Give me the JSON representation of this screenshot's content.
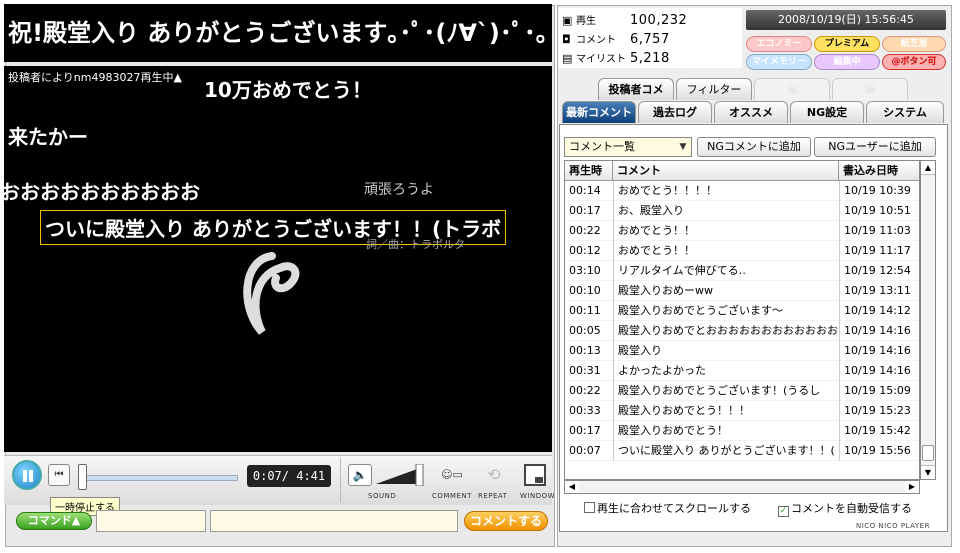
{
  "player": {
    "title": "祝!殿堂入り ありがとうございます｡･ﾟ･(ﾉ∀`)･ﾟ･｡",
    "status": "投稿者によりnm4983027再生中▲",
    "danmaku": [
      "10万おめでとう！",
      "来たかー",
      "おおおおおおおおおお",
      "ついに殿堂入り ありがとうございます！！(トラボ"
    ],
    "video_text": [
      "頑張ろうよ",
      "詞／曲：トラボルタ"
    ]
  },
  "controls": {
    "time": "0:07/ 4:41",
    "progress": 0.025,
    "labels": {
      "sound": "SOUND",
      "comment": "COMMENT",
      "repeat": "REPEAT",
      "window": "WINDOW"
    },
    "tooltip": "一時停止する",
    "command_button": "コマンド▲",
    "submit_button": "コメントする",
    "command_value": "",
    "comment_value": ""
  },
  "stats": {
    "plays_label": "再生",
    "plays": "100,232",
    "comments_label": "コメント",
    "comments": "6,757",
    "mylist_label": "マイリスト",
    "mylist": "5,218"
  },
  "datetime": "2008/10/19(日) 15:56:45",
  "badges": [
    "エコノミー",
    "プレミアム",
    "紙芝居",
    "マイメモリー",
    "編集中",
    "@ボタン可"
  ],
  "tabs": {
    "top": [
      "投稿者コメ",
      "フィルター"
    ],
    "main": [
      "最新コメント",
      "過去ログ",
      "オススメ",
      "NG設定",
      "システム"
    ]
  },
  "panel": {
    "select_value": "コメント一覧",
    "ng_comment_button": "NGコメントに追加",
    "ng_user_button": "NGユーザーに追加",
    "headers": [
      "再生時",
      "コメント",
      "書込み日時"
    ],
    "rows": [
      {
        "time": "00:14",
        "comment": "おめでとう！！！！",
        "date": "10/19 10:39"
      },
      {
        "time": "00:17",
        "comment": "お、殿堂入り",
        "date": "10/19 10:51"
      },
      {
        "time": "00:22",
        "comment": "おめでとう！！",
        "date": "10/19 11:03"
      },
      {
        "time": "00:12",
        "comment": "おめでとう！！",
        "date": "10/19 11:17"
      },
      {
        "time": "03:10",
        "comment": "リアルタイムで伸びてる‥",
        "date": "10/19 12:54"
      },
      {
        "time": "00:10",
        "comment": "殿堂入りおめーww",
        "date": "10/19 13:11"
      },
      {
        "time": "00:11",
        "comment": "殿堂入りおめでとうございます〜",
        "date": "10/19 14:12"
      },
      {
        "time": "00:05",
        "comment": "殿堂入りおめでとおおおおおおおおおおおお",
        "date": "10/19 14:16"
      },
      {
        "time": "00:13",
        "comment": "殿堂入り",
        "date": "10/19 14:16"
      },
      {
        "time": "00:31",
        "comment": "よかったよかった",
        "date": "10/19 14:16"
      },
      {
        "time": "00:22",
        "comment": "殿堂入りおめでとうございます！(うるし",
        "date": "10/19 15:09"
      },
      {
        "time": "00:33",
        "comment": "殿堂入りおめでとう！！！",
        "date": "10/19 15:23"
      },
      {
        "time": "00:17",
        "comment": "殿堂入りおめでとう！",
        "date": "10/19 15:42"
      },
      {
        "time": "00:07",
        "comment": "ついに殿堂入り ありがとうございます！！(",
        "date": "10/19 15:56"
      }
    ],
    "chk_scroll_label": "再生に合わせてスクロールする",
    "chk_scroll": false,
    "chk_auto_label": "コメントを自動受信する",
    "chk_auto": true,
    "footer": "NICO NICO PLAYER"
  },
  "colors": {
    "active_tab": "#0d3f7a",
    "accent": "#2a8fd0",
    "submit": "#f09000",
    "command": "#3aa020"
  }
}
